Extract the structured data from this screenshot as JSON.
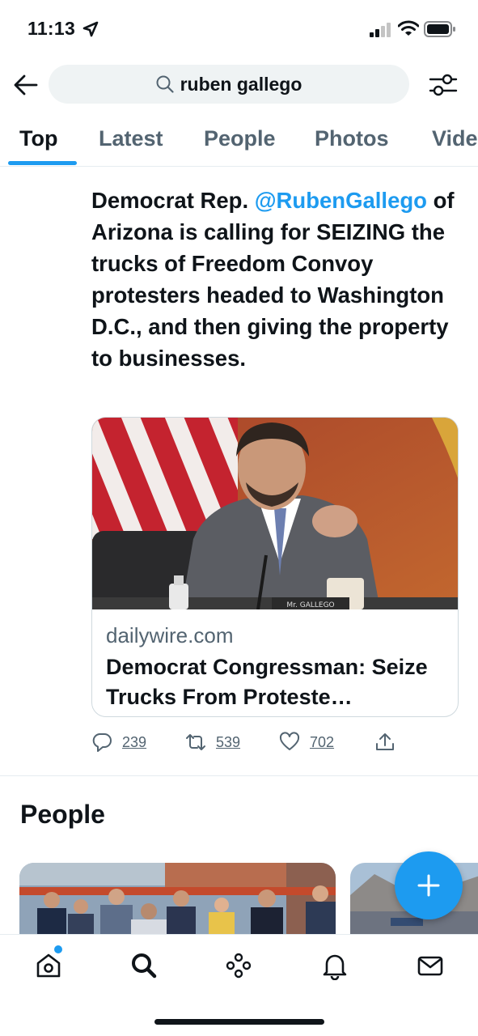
{
  "status_bar": {
    "time": "11:13"
  },
  "search": {
    "query": "ruben gallego"
  },
  "tabs": [
    {
      "label": "Top",
      "active": true
    },
    {
      "label": "Latest",
      "active": false
    },
    {
      "label": "People",
      "active": false
    },
    {
      "label": "Photos",
      "active": false
    },
    {
      "label": "Vide",
      "active": false
    }
  ],
  "tweet": {
    "text_before": "Democrat Rep. ",
    "mention": "@RubenGallego",
    "text_after": " of Arizona is calling for SEIZING the trucks of Freedom Convoy protesters headed to Washington D.C., and then giving the property to businesses.",
    "card": {
      "domain": "dailywire.com",
      "title": "Democrat Congressman: Seize Trucks From Proteste…",
      "nameplate": "Mr. GALLEGO"
    },
    "actions": {
      "replies": "239",
      "retweets": "539",
      "likes": "702"
    }
  },
  "people_section": {
    "title": "People"
  },
  "colors": {
    "accent": "#1d9bf0",
    "text": "#0f1419",
    "secondary_text": "#536471",
    "search_bg": "#eff3f4"
  },
  "icons": {
    "back": "back-arrow-icon",
    "search": "search-icon",
    "filter": "filter-sliders-icon",
    "reply": "reply-icon",
    "retweet": "retweet-icon",
    "like": "heart-icon",
    "share": "share-icon",
    "compose": "plus-icon",
    "nav": [
      "home-icon",
      "search-icon",
      "spaces-icon",
      "bell-icon",
      "mail-icon"
    ]
  }
}
